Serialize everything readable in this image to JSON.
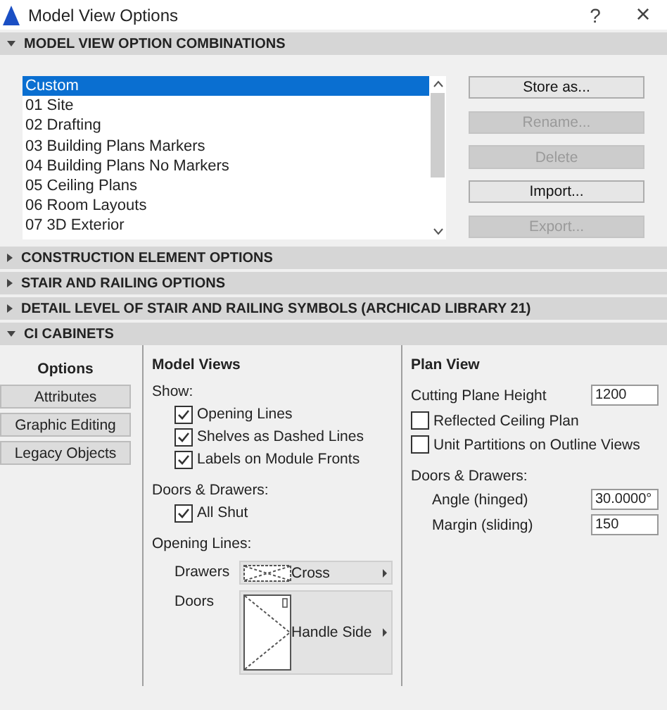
{
  "window": {
    "title": "Model View Options",
    "help": "?",
    "close": "×"
  },
  "combinations": {
    "title": "MODEL VIEW OPTION COMBINATIONS",
    "expanded": true,
    "items": [
      {
        "label": "Custom",
        "selected": true
      },
      {
        "label": "01 Site",
        "selected": false
      },
      {
        "label": "02 Drafting",
        "selected": false
      },
      {
        "label": "03 Building Plans Markers",
        "selected": false
      },
      {
        "label": "04 Building Plans No Markers",
        "selected": false
      },
      {
        "label": "05 Ceiling Plans",
        "selected": false
      },
      {
        "label": "06 Room Layouts",
        "selected": false
      },
      {
        "label": "07 3D Exterior",
        "selected": false
      }
    ],
    "buttons": [
      {
        "label": "Store as...",
        "disabled": false
      },
      {
        "label": "Rename...",
        "disabled": true
      },
      {
        "label": "Delete",
        "disabled": true
      },
      {
        "label": "Import...",
        "disabled": false
      },
      {
        "label": "Export...",
        "disabled": true
      }
    ]
  },
  "sections": [
    {
      "title": "CONSTRUCTION ELEMENT OPTIONS",
      "expanded": false
    },
    {
      "title": "STAIR AND RAILING OPTIONS",
      "expanded": false
    },
    {
      "title": "DETAIL LEVEL OF STAIR AND RAILING SYMBOLS (ARCHICAD LIBRARY 21)",
      "expanded": false
    },
    {
      "title": "CI CABINETS",
      "expanded": true
    }
  ],
  "cabinets": {
    "tabs": [
      {
        "label": "Options",
        "selected": true
      },
      {
        "label": "Attributes",
        "selected": false
      },
      {
        "label": "Graphic Editing",
        "selected": false
      },
      {
        "label": "Legacy Objects",
        "selected": false
      }
    ],
    "model_views": {
      "title": "Model Views",
      "show_label": "Show:",
      "show": [
        {
          "label": "Opening Lines",
          "checked": true
        },
        {
          "label": "Shelves as Dashed Lines",
          "checked": true
        },
        {
          "label": "Labels on Module Fronts",
          "checked": true
        }
      ],
      "doors_drawers_label": "Doors & Drawers:",
      "doors_drawers": [
        {
          "label": "All Shut",
          "checked": true
        }
      ],
      "opening_lines_label": "Opening Lines:",
      "drawers": {
        "label": "Drawers",
        "value": "Cross"
      },
      "doors": {
        "label": "Doors",
        "value": "Handle Side"
      }
    },
    "plan_view": {
      "title": "Plan View",
      "cutting_plane": {
        "label": "Cutting Plane Height",
        "value": "1200"
      },
      "options": [
        {
          "label": "Reflected Ceiling Plan",
          "checked": false
        },
        {
          "label": "Unit Partitions on Outline Views",
          "checked": false
        }
      ],
      "doors_drawers_label": "Doors & Drawers:",
      "fields": [
        {
          "label": "Angle (hinged)",
          "value": "30.0000°"
        },
        {
          "label": "Margin (sliding)",
          "value": "150"
        }
      ]
    }
  }
}
